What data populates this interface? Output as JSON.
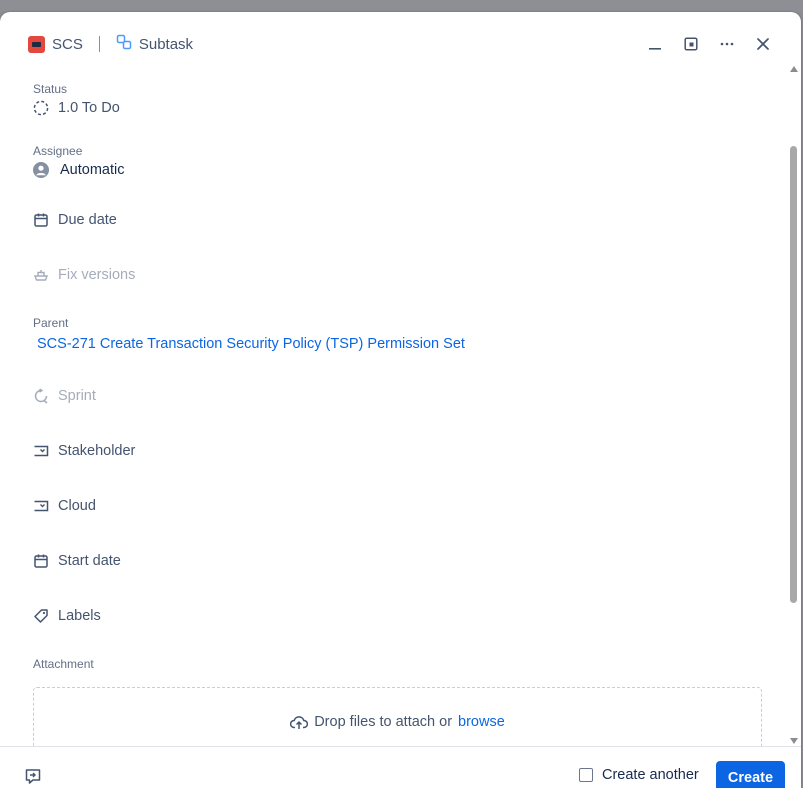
{
  "header": {
    "project": "SCS",
    "issue_type": "Subtask"
  },
  "fields": {
    "status": {
      "label": "Status",
      "value": "1.0 To Do"
    },
    "assignee": {
      "label": "Assignee",
      "value": "Automatic"
    },
    "due_date": {
      "label": "Due date"
    },
    "fix_versions": {
      "label": "Fix versions"
    },
    "parent": {
      "label": "Parent",
      "value": "SCS-271 Create Transaction Security Policy (TSP) Permission Set"
    },
    "sprint": {
      "label": "Sprint"
    },
    "stakeholder": {
      "label": "Stakeholder"
    },
    "cloud": {
      "label": "Cloud"
    },
    "start_date": {
      "label": "Start date"
    },
    "labels": {
      "label": "Labels"
    },
    "attachment": {
      "label": "Attachment",
      "drop_text": "Drop files to attach or",
      "browse_text": "browse"
    }
  },
  "footer": {
    "create_another": "Create another",
    "create": "Create"
  },
  "colors": {
    "accent": "#0c66e4",
    "project_icon": "#e2483d"
  },
  "icons": [
    "project-icon",
    "subtask-icon",
    "minimize-icon",
    "shrink-icon",
    "more-icon",
    "close-icon",
    "status-icon",
    "avatar-icon",
    "calendar-icon",
    "ship-icon",
    "sprint-icon",
    "dropdown-field-icon",
    "tag-icon",
    "upload-icon",
    "feedback-icon"
  ]
}
